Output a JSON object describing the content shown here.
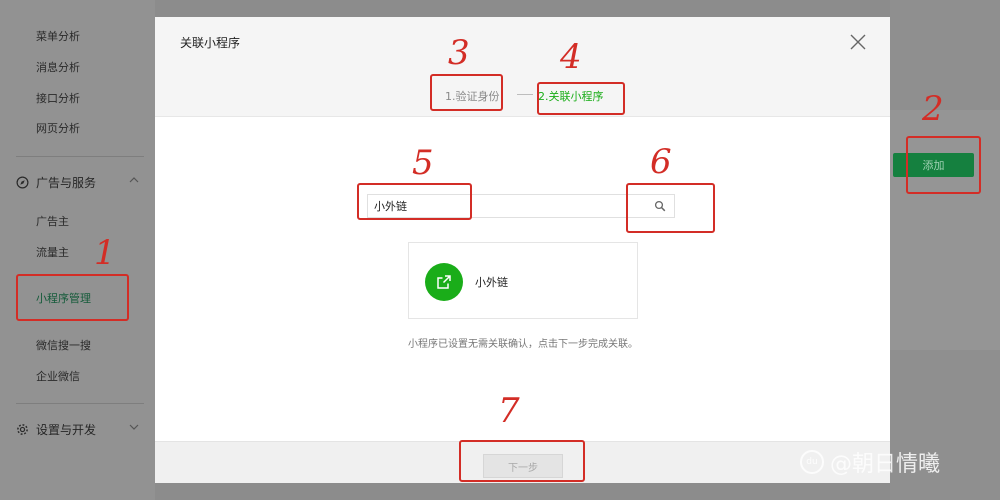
{
  "sidebar": {
    "items_top": [
      "菜单分析",
      "消息分析",
      "接口分析",
      "网页分析"
    ],
    "section_ads": "广告与服务",
    "items_ads": [
      "广告主",
      "流量主",
      "小程序管理",
      "微信搜一搜",
      "企业微信"
    ],
    "section_settings": "设置与开发"
  },
  "background": {
    "add_label": "添加"
  },
  "modal": {
    "title": "关联小程序",
    "steps": [
      "1.验证身份",
      "2.关联小程序"
    ],
    "search": {
      "value": "小外链"
    },
    "result": {
      "name": "小外链"
    },
    "hint": "小程序已设置无需关联确认，点击下一步完成关联。",
    "next_label": "下一步"
  },
  "annotations": [
    "1",
    "2",
    "3",
    "4",
    "5",
    "6",
    "7"
  ],
  "watermark": "@朝日情曦",
  "colors": {
    "accent_green": "#1aad19",
    "annotation_red": "#d32d26"
  }
}
